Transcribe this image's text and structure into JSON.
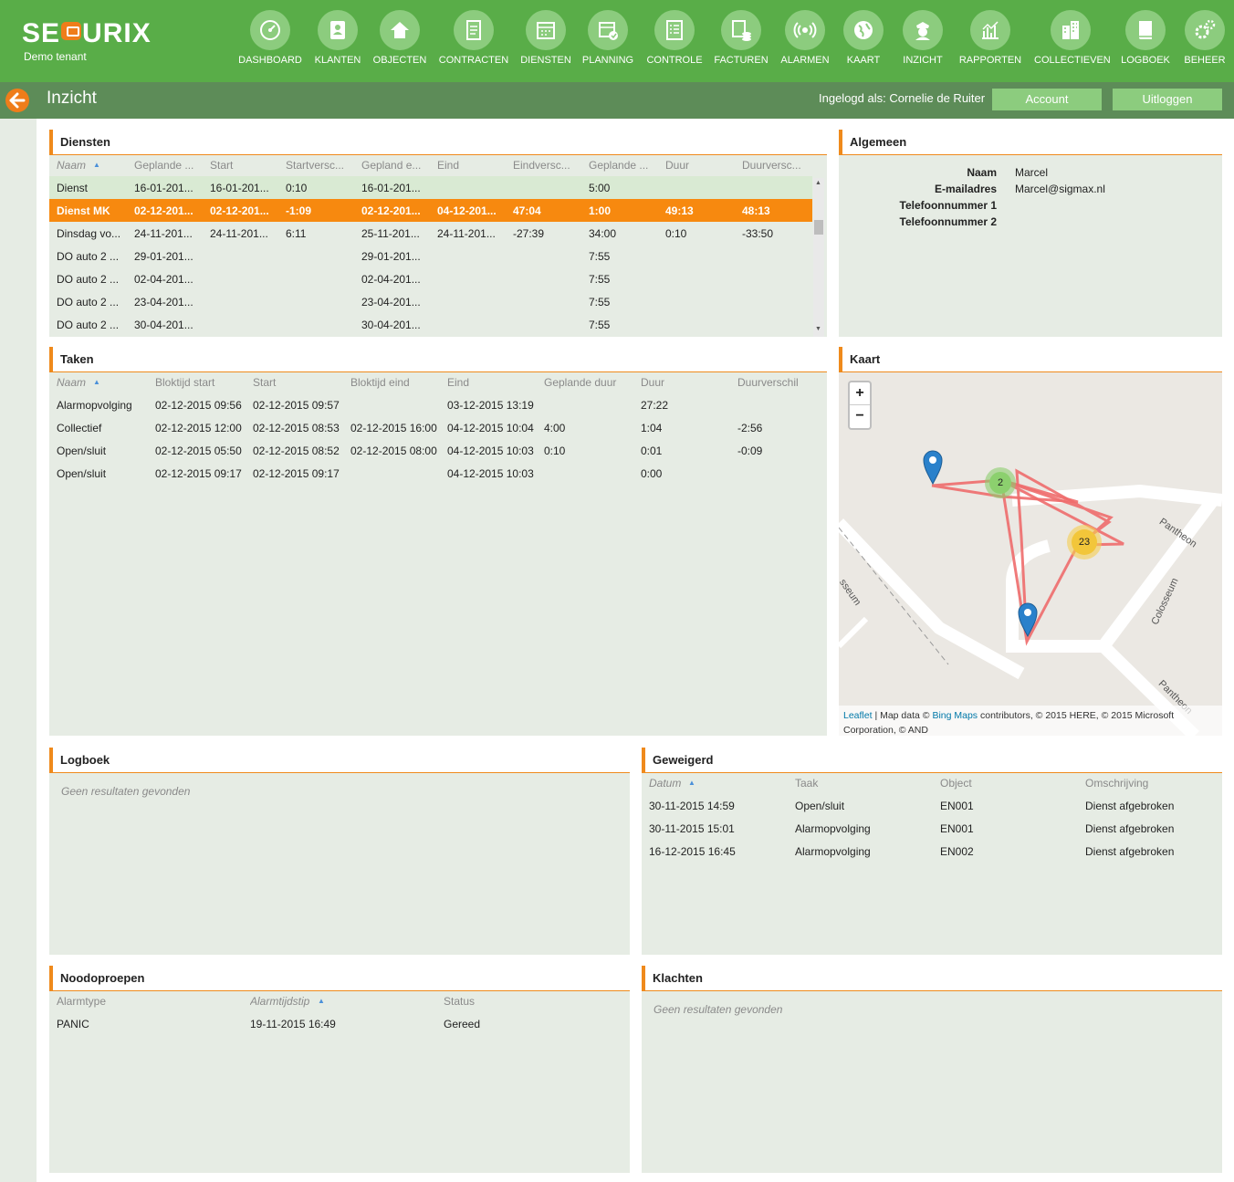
{
  "app": {
    "logo": "SEQURIX",
    "tenant": "Demo tenant"
  },
  "nav": [
    "DASHBOARD",
    "KLANTEN",
    "OBJECTEN",
    "CONTRACTEN",
    "DIENSTEN",
    "PLANNING",
    "CONTROLE",
    "FACTUREN",
    "ALARMEN",
    "KAART",
    "INZICHT",
    "RAPPORTEN",
    "COLLECTIEVEN",
    "LOGBOEK",
    "BEHEER"
  ],
  "header": {
    "title": "Inzicht",
    "logged_in": "Ingelogd als: Cornelie de Ruiter",
    "account": "Account",
    "logout": "Uitloggen"
  },
  "diensten": {
    "title": "Diensten",
    "columns": [
      "Naam",
      "Geplande ...",
      "Start",
      "Startversc...",
      "Gepland e...",
      "Eind",
      "Eindversc...",
      "Geplande ...",
      "Duur",
      "Duurversc..."
    ],
    "rows": [
      [
        "Dienst",
        "16-01-201...",
        "16-01-201...",
        "0:10",
        "16-01-201...",
        "",
        "",
        "5:00",
        "",
        ""
      ],
      [
        "Dienst MK",
        "02-12-201...",
        "02-12-201...",
        "-1:09",
        "02-12-201...",
        "04-12-201...",
        "47:04",
        "1:00",
        "49:13",
        "48:13"
      ],
      [
        "Dinsdag vo...",
        "24-11-201...",
        "24-11-201...",
        "6:11",
        "25-11-201...",
        "24-11-201...",
        "-27:39",
        "34:00",
        "0:10",
        "-33:50"
      ],
      [
        "DO auto 2 ...",
        "29-01-201...",
        "",
        "",
        "29-01-201...",
        "",
        "",
        "7:55",
        "",
        ""
      ],
      [
        "DO auto 2 ...",
        "02-04-201...",
        "",
        "",
        "02-04-201...",
        "",
        "",
        "7:55",
        "",
        ""
      ],
      [
        "DO auto 2 ...",
        "23-04-201...",
        "",
        "",
        "23-04-201...",
        "",
        "",
        "7:55",
        "",
        ""
      ],
      [
        "DO auto 2 ...",
        "30-04-201...",
        "",
        "",
        "30-04-201...",
        "",
        "",
        "7:55",
        "",
        ""
      ]
    ]
  },
  "algemeen": {
    "title": "Algemeen",
    "fields": [
      {
        "label": "Naam",
        "value": "Marcel"
      },
      {
        "label": "E-mailadres",
        "value": "Marcel@sigmax.nl"
      },
      {
        "label": "Telefoonnummer 1",
        "value": ""
      },
      {
        "label": "Telefoonnummer 2",
        "value": ""
      }
    ]
  },
  "taken": {
    "title": "Taken",
    "columns": [
      "Naam",
      "Bloktijd start",
      "Start",
      "Bloktijd eind",
      "Eind",
      "Geplande duur",
      "Duur",
      "Duurverschil"
    ],
    "rows": [
      [
        "Alarmopvolging",
        "02-12-2015 09:56",
        "02-12-2015 09:57",
        "",
        "03-12-2015 13:19",
        "",
        "27:22",
        ""
      ],
      [
        "Collectief",
        "02-12-2015 12:00",
        "02-12-2015 08:53",
        "02-12-2015 16:00",
        "04-12-2015 10:04",
        "4:00",
        "1:04",
        "-2:56"
      ],
      [
        "Open/sluit",
        "02-12-2015 05:50",
        "02-12-2015 08:52",
        "02-12-2015 08:00",
        "04-12-2015 10:03",
        "0:10",
        "0:01",
        "-0:09"
      ],
      [
        "Open/sluit",
        "02-12-2015 09:17",
        "02-12-2015 09:17",
        "",
        "04-12-2015 10:03",
        "",
        "0:00",
        ""
      ]
    ]
  },
  "kaart": {
    "title": "Kaart",
    "zoom_in": "+",
    "zoom_out": "−",
    "cluster_small": "2",
    "cluster_large": "23",
    "streets": [
      "Pantheon",
      "Colosseum",
      "Pantheon",
      "sseum"
    ],
    "attribution_leaflet": "Leaflet",
    "attribution_mid": " | Map data © ",
    "attribution_bing": "Bing Maps",
    "attribution_rest": " contributors, © 2015 HERE, © 2015 Microsoft",
    "attribution_line2": "Corporation, © AND"
  },
  "logboek": {
    "title": "Logboek",
    "empty": "Geen resultaten gevonden"
  },
  "geweigerd": {
    "title": "Geweigerd",
    "columns": [
      "Datum",
      "Taak",
      "Object",
      "Omschrijving"
    ],
    "rows": [
      [
        "30-11-2015 14:59",
        "Open/sluit",
        "EN001",
        "Dienst afgebroken"
      ],
      [
        "30-11-2015 15:01",
        "Alarmopvolging",
        "EN001",
        "Dienst afgebroken"
      ],
      [
        "16-12-2015 16:45",
        "Alarmopvolging",
        "EN002",
        "Dienst afgebroken"
      ]
    ]
  },
  "noodoproepen": {
    "title": "Noodoproepen",
    "columns": [
      "Alarmtype",
      "Alarmtijdstip",
      "Status"
    ],
    "rows": [
      [
        "PANIC",
        "19-11-2015 16:49",
        "Gereed"
      ]
    ]
  },
  "klachten": {
    "title": "Klachten",
    "empty": "Geen resultaten gevonden"
  },
  "colors": {
    "brand_green": "#59ad48",
    "header_dark_green": "#5d8c58",
    "accent_orange": "#ef8a1c",
    "panel_bg": "#e6ece4",
    "selected_row": "#f7890f",
    "route_red": "#ee6b6b"
  },
  "icons": [
    "speedometer-icon",
    "address-book-icon",
    "house-icon",
    "document-icon",
    "calendar-icon",
    "planning-calendar-icon",
    "checklist-icon",
    "invoice-coins-icon",
    "broadcast-icon",
    "globe-icon",
    "guard-icon",
    "chart-icon",
    "buildings-icon",
    "book-icon",
    "gears-icon"
  ]
}
